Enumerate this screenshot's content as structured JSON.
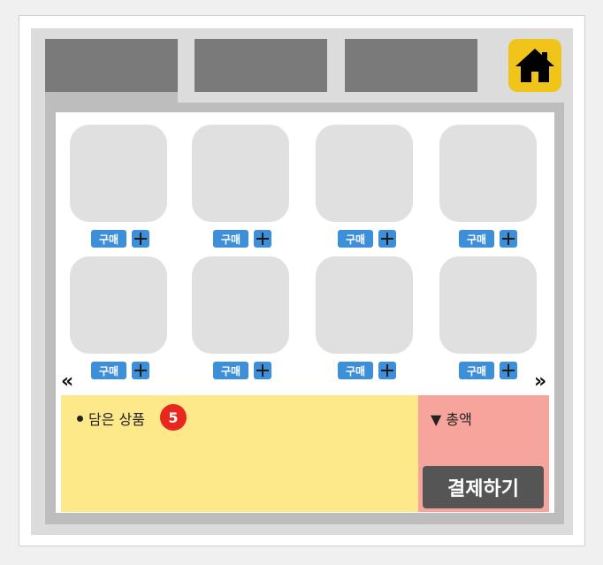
{
  "tabs": [
    {
      "label": ""
    },
    {
      "label": ""
    },
    {
      "label": ""
    }
  ],
  "home": {
    "icon": "home-icon",
    "color": "#f0c419"
  },
  "products": [
    {
      "buy_label": "구매"
    },
    {
      "buy_label": "구매"
    },
    {
      "buy_label": "구매"
    },
    {
      "buy_label": "구매"
    },
    {
      "buy_label": "구매"
    },
    {
      "buy_label": "구매"
    },
    {
      "buy_label": "구매"
    },
    {
      "buy_label": "구매"
    }
  ],
  "pager": {
    "prev": "«",
    "next": "»"
  },
  "cart": {
    "label": "담은 상품",
    "count": "5"
  },
  "total": {
    "label": "▼ 총액"
  },
  "checkout": {
    "label": "결제하기"
  }
}
